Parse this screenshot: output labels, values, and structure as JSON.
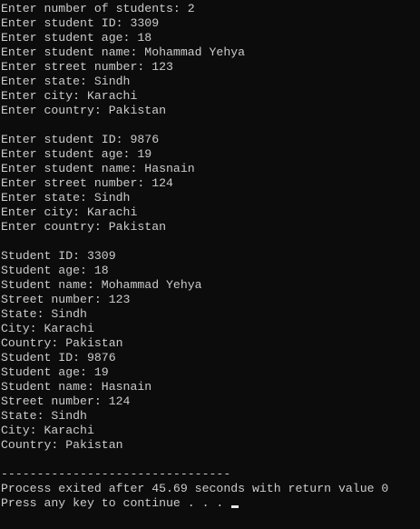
{
  "console": {
    "lines": [
      "Enter number of students: 2",
      "Enter student ID: 3309",
      "Enter student age: 18",
      "Enter student name: Mohammad Yehya",
      "Enter street number: 123",
      "Enter state: Sindh",
      "Enter city: Karachi",
      "Enter country: Pakistan",
      "",
      "Enter student ID: 9876",
      "Enter student age: 19",
      "Enter student name: Hasnain",
      "Enter street number: 124",
      "Enter state: Sindh",
      "Enter city: Karachi",
      "Enter country: Pakistan",
      "",
      "Student ID: 3309",
      "Student age: 18",
      "Student name: Mohammad Yehya",
      "Street number: 123",
      "State: Sindh",
      "City: Karachi",
      "Country: Pakistan",
      "Student ID: 9876",
      "Student age: 19",
      "Student name: Hasnain",
      "Street number: 124",
      "State: Sindh",
      "City: Karachi",
      "Country: Pakistan",
      "",
      "--------------------------------",
      "Process exited after 45.69 seconds with return value 0",
      "Press any key to continue . . . "
    ],
    "colors": {
      "background": "#0c0c0c",
      "text": "#cccccc",
      "cursor": "#e6e6e6"
    }
  }
}
